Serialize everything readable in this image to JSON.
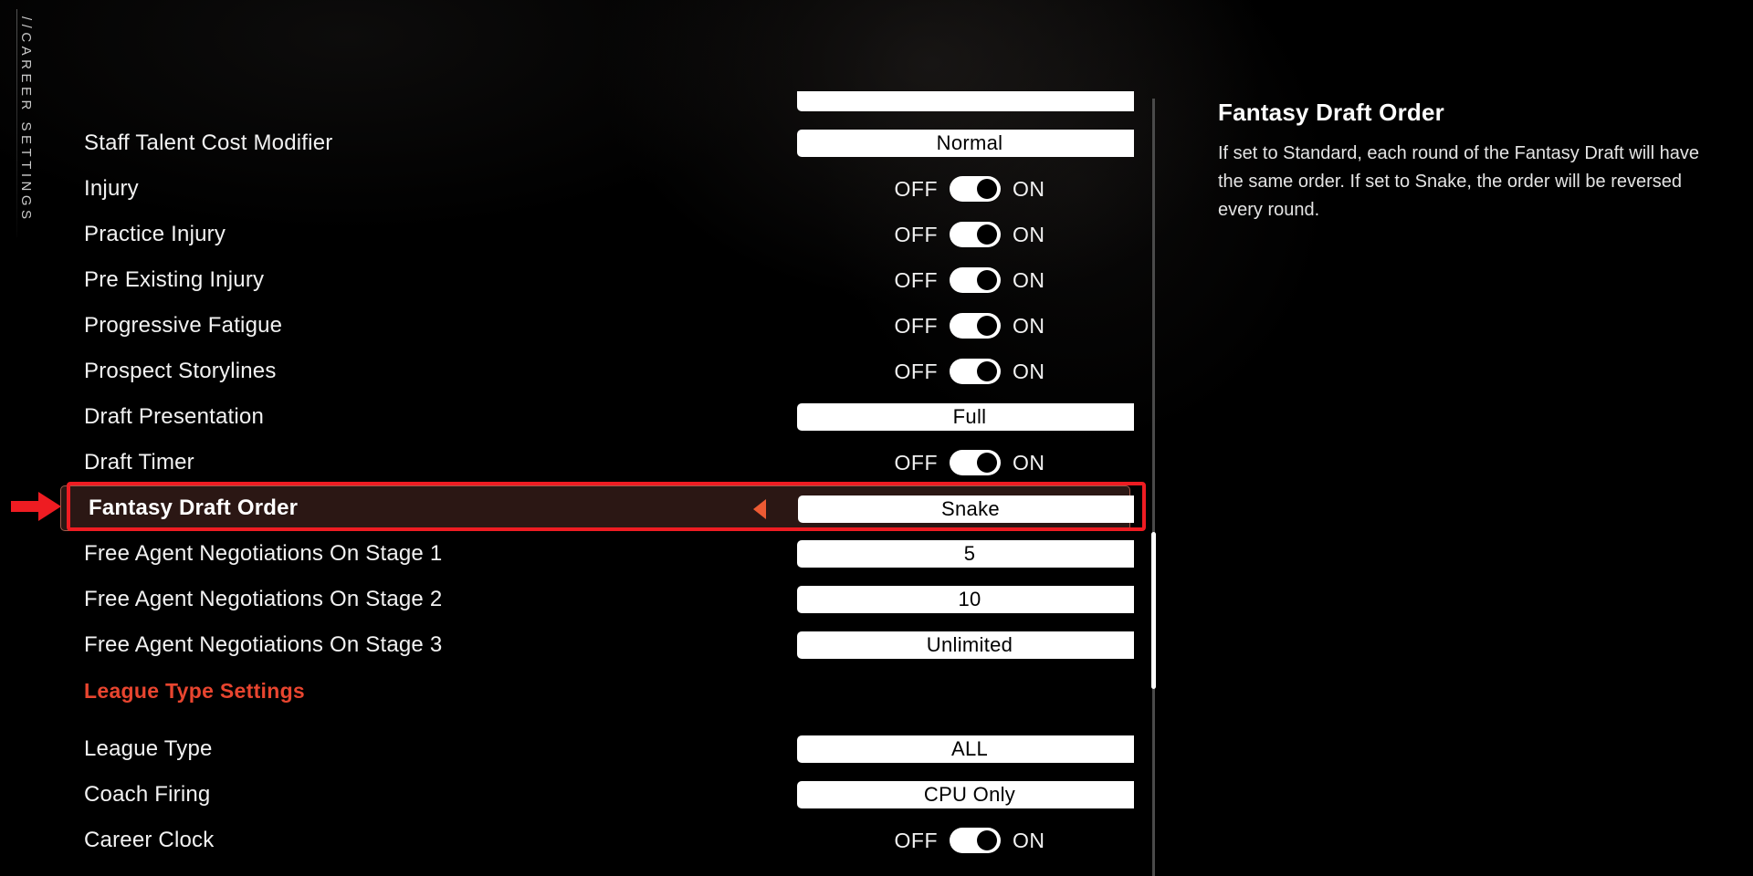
{
  "rail": {
    "label": "//CAREER SETTINGS"
  },
  "toggle": {
    "off_label": "OFF",
    "on_label": "ON"
  },
  "colors": {
    "accent_red": "#e8452f",
    "annotation_red": "#ee1c22",
    "selected_arrow": "#ec5a33",
    "selected_fill": "#2b1714",
    "value_box_bg": "#ffffff",
    "text_primary": "#f2f2f2"
  },
  "settings_list": {
    "partial_row": {
      "type": "value",
      "label": "",
      "value": ""
    },
    "rows": [
      {
        "type": "value",
        "label": "Staff Talent Cost Modifier",
        "value": "Normal",
        "selected": false
      },
      {
        "type": "toggle",
        "label": "Injury",
        "value": "ON",
        "selected": false
      },
      {
        "type": "toggle",
        "label": "Practice Injury",
        "value": "ON",
        "selected": false
      },
      {
        "type": "toggle",
        "label": "Pre Existing Injury",
        "value": "ON",
        "selected": false
      },
      {
        "type": "toggle",
        "label": "Progressive Fatigue",
        "value": "ON",
        "selected": false
      },
      {
        "type": "toggle",
        "label": "Prospect Storylines",
        "value": "ON",
        "selected": false
      },
      {
        "type": "value",
        "label": "Draft Presentation",
        "value": "Full",
        "selected": false
      },
      {
        "type": "toggle",
        "label": "Draft Timer",
        "value": "ON",
        "selected": false
      },
      {
        "type": "value",
        "label": "Fantasy Draft Order",
        "value": "Snake",
        "selected": true
      },
      {
        "type": "value",
        "label": "Free Agent Negotiations On Stage 1",
        "value": "5",
        "selected": false
      },
      {
        "type": "value",
        "label": "Free Agent Negotiations On Stage 2",
        "value": "10",
        "selected": false
      },
      {
        "type": "value",
        "label": "Free Agent Negotiations On Stage 3",
        "value": "Unlimited",
        "selected": false
      },
      {
        "type": "header",
        "label": "League Type Settings",
        "value": "",
        "selected": false
      },
      {
        "type": "value",
        "label": "League Type",
        "value": "ALL",
        "selected": false
      },
      {
        "type": "value",
        "label": "Coach Firing",
        "value": "CPU Only",
        "selected": false
      },
      {
        "type": "toggle",
        "label": "Career Clock",
        "value": "ON",
        "selected": false
      }
    ]
  },
  "info_panel": {
    "title": "Fantasy Draft Order",
    "description": "If set to Standard, each round of the Fantasy Draft will have the same order. If set to Snake, the order will be reversed every round."
  },
  "annotation": {
    "arrow_icon": "right-arrow-icon",
    "target_row": "Fantasy Draft Order"
  }
}
